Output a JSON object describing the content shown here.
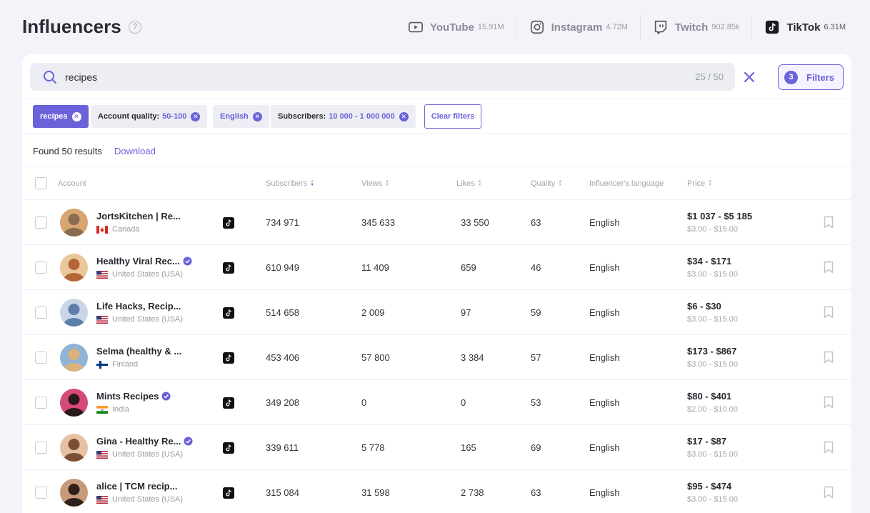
{
  "header": {
    "title": "Influencers",
    "help_glyph": "?",
    "platforms": [
      {
        "name": "YouTube",
        "count": "15.91M",
        "icon": "youtube-icon",
        "active": false
      },
      {
        "name": "Instagram",
        "count": "4.72M",
        "icon": "instagram-icon",
        "active": false
      },
      {
        "name": "Twitch",
        "count": "902.85k",
        "icon": "twitch-icon",
        "active": false
      },
      {
        "name": "TikTok",
        "count": "6.31M",
        "icon": "tiktok-icon",
        "active": true
      }
    ]
  },
  "search": {
    "value": "recipes",
    "counter": "25 / 50"
  },
  "filters_button": {
    "count": "3",
    "label": "Filters"
  },
  "chips": [
    {
      "label": "recipes",
      "value": ""
    },
    {
      "label": "Account quality:",
      "value": "50-100"
    },
    {
      "label": "English",
      "value": ""
    },
    {
      "label": "Subscribers:",
      "value": "10 000 - 1 000 000"
    }
  ],
  "clear_filters_label": "Clear filters",
  "results": {
    "text": "Found 50 results",
    "download_label": "Download"
  },
  "columns": {
    "account": "Account",
    "subscribers": "Subscribers",
    "views": "Views",
    "likes": "Likes",
    "quality": "Quality",
    "language": "Influencer's language",
    "price": "Price"
  },
  "colors": {
    "accent": "#6b62d9",
    "background": "#f3f4fa"
  },
  "rows": [
    {
      "name": "JortsKitchen | Re...",
      "verified": false,
      "country": "Canada",
      "flag": "ca",
      "subscribers": "734 971",
      "views": "345 633",
      "likes": "33 550",
      "quality": "63",
      "language": "English",
      "price": "$1 037 - $5 185",
      "price_range": "$3.00 - $15.00",
      "avatar_colors": [
        "#8a6b4f",
        "#d7a56f"
      ]
    },
    {
      "name": "Healthy Viral Rec...",
      "verified": true,
      "country": "United States (USA)",
      "flag": "us",
      "subscribers": "610 949",
      "views": "11 409",
      "likes": "659",
      "quality": "46",
      "language": "English",
      "price": "$34 - $171",
      "price_range": "$3.00 - $15.00",
      "avatar_colors": [
        "#b5653a",
        "#e9c79a"
      ]
    },
    {
      "name": "Life Hacks, Recip...",
      "verified": false,
      "country": "United States (USA)",
      "flag": "us",
      "subscribers": "514 658",
      "views": "2 009",
      "likes": "97",
      "quality": "59",
      "language": "English",
      "price": "$6 - $30",
      "price_range": "$3.00 - $15.00",
      "avatar_colors": [
        "#5d7ea8",
        "#c9d6e6"
      ]
    },
    {
      "name": "Selma (healthy & ...",
      "verified": false,
      "country": "Finland",
      "flag": "fi",
      "subscribers": "453 406",
      "views": "57 800",
      "likes": "3 384",
      "quality": "57",
      "language": "English",
      "price": "$173 - $867",
      "price_range": "$3.00 - $15.00",
      "avatar_colors": [
        "#d9b27c",
        "#8fb4d6"
      ]
    },
    {
      "name": "Mints Recipes",
      "verified": true,
      "country": "India",
      "flag": "in",
      "subscribers": "349 208",
      "views": "0",
      "likes": "0",
      "quality": "53",
      "language": "English",
      "price": "$80 - $401",
      "price_range": "$2.00 - $10.00",
      "avatar_colors": [
        "#2a1a1a",
        "#d64a7a"
      ]
    },
    {
      "name": "Gina - Healthy Re...",
      "verified": true,
      "country": "United States (USA)",
      "flag": "us",
      "subscribers": "339 611",
      "views": "5 778",
      "likes": "165",
      "quality": "69",
      "language": "English",
      "price": "$17 - $87",
      "price_range": "$3.00 - $15.00",
      "avatar_colors": [
        "#7a4f36",
        "#e6c2a3"
      ]
    },
    {
      "name": "alice | TCM recip...",
      "verified": false,
      "country": "United States (USA)",
      "flag": "us",
      "subscribers": "315 084",
      "views": "31 598",
      "likes": "2 738",
      "quality": "63",
      "language": "English",
      "price": "$95 - $474",
      "price_range": "$3.00 - $15.00",
      "avatar_colors": [
        "#2e211c",
        "#c79a7c"
      ]
    }
  ]
}
